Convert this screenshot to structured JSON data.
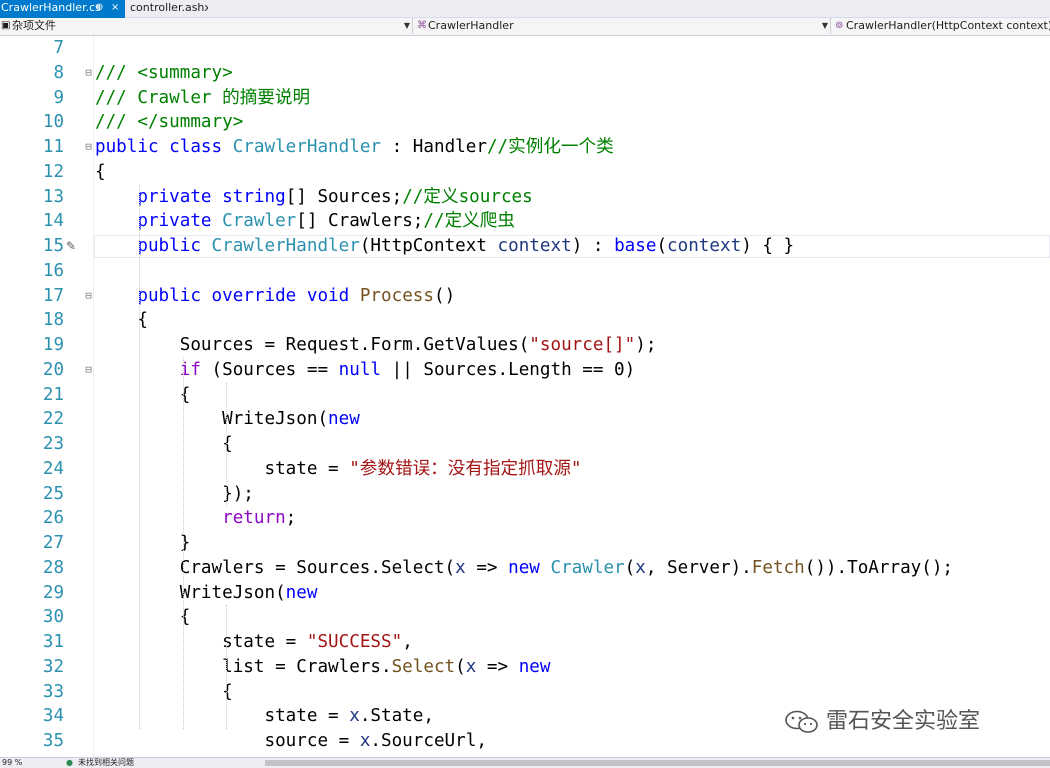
{
  "tabs": [
    {
      "label": "CrawlerHandler.cs",
      "pin": "⊕",
      "close": "×"
    },
    {
      "label": "controller.ashx"
    }
  ],
  "navbar": {
    "project": "杂项文件",
    "class": "CrawlerHandler",
    "member": "CrawlerHandler(HttpContext context)"
  },
  "editor": {
    "line_numbers": [
      "7",
      "8",
      "9",
      "10",
      "11",
      "12",
      "13",
      "14",
      "15",
      "16",
      "17",
      "18",
      "19",
      "20",
      "21",
      "22",
      "23",
      "24",
      "25",
      "26",
      "27",
      "28",
      "29",
      "30",
      "31",
      "32",
      "33",
      "34",
      "35"
    ],
    "lines": [
      [],
      [
        {
          "t": "cm",
          "v": "/// <summary>"
        }
      ],
      [
        {
          "t": "cm",
          "v": "/// Crawler 的摘要说明"
        }
      ],
      [
        {
          "t": "cm",
          "v": "/// </summary>"
        }
      ],
      [
        {
          "t": "kw",
          "v": "public"
        },
        {
          "t": "",
          "v": " "
        },
        {
          "t": "kw",
          "v": "class"
        },
        {
          "t": "",
          "v": " "
        },
        {
          "t": "ty",
          "v": "CrawlerHandler"
        },
        {
          "t": "",
          "v": " : Handler"
        },
        {
          "t": "cm",
          "v": "//实例化一个类"
        }
      ],
      [
        {
          "t": "",
          "v": "{"
        }
      ],
      [
        {
          "t": "",
          "v": "    "
        },
        {
          "t": "kw",
          "v": "private"
        },
        {
          "t": "",
          "v": " "
        },
        {
          "t": "kw",
          "v": "string"
        },
        {
          "t": "",
          "v": "[] Sources;"
        },
        {
          "t": "cm",
          "v": "//定义sources"
        }
      ],
      [
        {
          "t": "",
          "v": "    "
        },
        {
          "t": "kw",
          "v": "private"
        },
        {
          "t": "",
          "v": " "
        },
        {
          "t": "ty",
          "v": "Crawler"
        },
        {
          "t": "",
          "v": "[] Crawlers;"
        },
        {
          "t": "cm",
          "v": "//定义爬虫"
        }
      ],
      [
        {
          "t": "",
          "v": "    "
        },
        {
          "t": "kw",
          "v": "public"
        },
        {
          "t": "",
          "v": " "
        },
        {
          "t": "ty",
          "v": "CrawlerHandler"
        },
        {
          "t": "",
          "v": "(HttpContext "
        },
        {
          "t": "pa",
          "v": "context"
        },
        {
          "t": "",
          "v": ") : "
        },
        {
          "t": "kw",
          "v": "base"
        },
        {
          "t": "",
          "v": "("
        },
        {
          "t": "pa",
          "v": "context"
        },
        {
          "t": "",
          "v": ") { }"
        }
      ],
      [],
      [
        {
          "t": "",
          "v": "    "
        },
        {
          "t": "kw",
          "v": "public"
        },
        {
          "t": "",
          "v": " "
        },
        {
          "t": "kw",
          "v": "override"
        },
        {
          "t": "",
          "v": " "
        },
        {
          "t": "kw",
          "v": "void"
        },
        {
          "t": "",
          "v": " "
        },
        {
          "t": "me",
          "v": "Process"
        },
        {
          "t": "",
          "v": "()"
        }
      ],
      [
        {
          "t": "",
          "v": "    {"
        }
      ],
      [
        {
          "t": "",
          "v": "        Sources = Request.Form.GetValues("
        },
        {
          "t": "st",
          "v": "\"source[]\""
        },
        {
          "t": "",
          "v": ");"
        }
      ],
      [
        {
          "t": "",
          "v": "        "
        },
        {
          "t": "ctl",
          "v": "if"
        },
        {
          "t": "",
          "v": " (Sources == "
        },
        {
          "t": "kw",
          "v": "null"
        },
        {
          "t": "",
          "v": " || Sources.Length == 0)"
        }
      ],
      [
        {
          "t": "",
          "v": "        {"
        }
      ],
      [
        {
          "t": "",
          "v": "            WriteJson("
        },
        {
          "t": "kw",
          "v": "new"
        }
      ],
      [
        {
          "t": "",
          "v": "            {"
        }
      ],
      [
        {
          "t": "",
          "v": "                state = "
        },
        {
          "t": "st",
          "v": "\"参数错误：没有指定抓取源\""
        }
      ],
      [
        {
          "t": "",
          "v": "            });"
        }
      ],
      [
        {
          "t": "",
          "v": "            "
        },
        {
          "t": "ctl",
          "v": "return"
        },
        {
          "t": "",
          "v": ";"
        }
      ],
      [
        {
          "t": "",
          "v": "        }"
        }
      ],
      [
        {
          "t": "",
          "v": "        Crawlers = Sources.Select("
        },
        {
          "t": "pa",
          "v": "x"
        },
        {
          "t": "",
          "v": " => "
        },
        {
          "t": "kw",
          "v": "new"
        },
        {
          "t": "",
          "v": " "
        },
        {
          "t": "ty",
          "v": "Crawler"
        },
        {
          "t": "",
          "v": "("
        },
        {
          "t": "pa",
          "v": "x"
        },
        {
          "t": "",
          "v": ", Server)."
        },
        {
          "t": "me",
          "v": "Fetch"
        },
        {
          "t": "",
          "v": "()).ToArray();"
        }
      ],
      [
        {
          "t": "",
          "v": "        WriteJson("
        },
        {
          "t": "kw",
          "v": "new"
        }
      ],
      [
        {
          "t": "",
          "v": "        {"
        }
      ],
      [
        {
          "t": "",
          "v": "            state = "
        },
        {
          "t": "st",
          "v": "\"SUCCESS\""
        },
        {
          "t": "",
          "v": ","
        }
      ],
      [
        {
          "t": "",
          "v": "            list = Crawlers."
        },
        {
          "t": "me",
          "v": "Select"
        },
        {
          "t": "",
          "v": "("
        },
        {
          "t": "pa",
          "v": "x"
        },
        {
          "t": "",
          "v": " => "
        },
        {
          "t": "kw",
          "v": "new"
        }
      ],
      [
        {
          "t": "",
          "v": "            {"
        }
      ],
      [
        {
          "t": "",
          "v": "                state = "
        },
        {
          "t": "pa",
          "v": "x"
        },
        {
          "t": "",
          "v": ".State,"
        }
      ],
      [
        {
          "t": "",
          "v": "                source = "
        },
        {
          "t": "pa",
          "v": "x"
        },
        {
          "t": "",
          "v": ".SourceUrl,"
        }
      ]
    ],
    "fold_markers": {
      "8": "⊟",
      "11": "⊟",
      "17": "⊟",
      "20": "⊟"
    },
    "edit_marker_line": "15",
    "current_line": "15"
  },
  "watermark": {
    "text": "雷石安全实验室",
    "icon": "wechat-icon"
  },
  "statusbar": {
    "zoom": "99 %",
    "issues": "未找到相关问题"
  },
  "colors": {
    "keyword": "#0000ff",
    "type": "#2b91af",
    "comment": "#008000",
    "string": "#a31515",
    "method": "#74531f",
    "param": "#1f377f",
    "control": "#8f08c4",
    "accent": "#007acc"
  }
}
